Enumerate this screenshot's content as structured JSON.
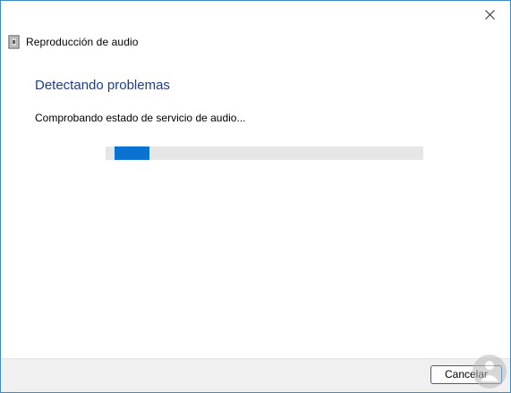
{
  "window": {
    "title": "Reproducción de audio",
    "app_icon": "troubleshooter-document-icon",
    "close_icon": "close-icon",
    "accent_color": "#3c8cc8"
  },
  "content": {
    "heading": "Detectando problemas",
    "status": "Comprobando estado de servicio de audio...",
    "heading_color": "#1e3c8c"
  },
  "progress": {
    "value": 0.11,
    "color": "#0a73d2",
    "track_color": "#e6e6e6"
  },
  "footer": {
    "cancel_label": "Cancelar"
  }
}
